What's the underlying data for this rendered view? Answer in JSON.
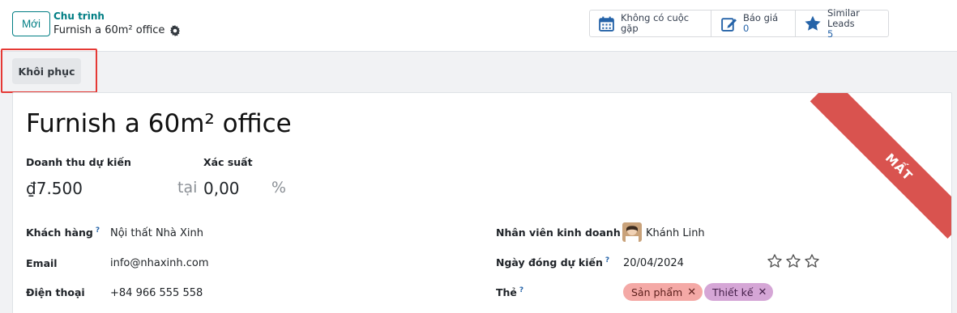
{
  "header": {
    "new_label": "Mới",
    "breadcrumb_parent": "Chu trình",
    "breadcrumb_current": "Furnish a 60m² office"
  },
  "smart_buttons": [
    {
      "icon": "calendar-icon",
      "label": "Không có cuộc gặp",
      "value": ""
    },
    {
      "icon": "edit-icon",
      "label": "Báo giá",
      "value": "0"
    },
    {
      "icon": "star-icon",
      "label": "Similar Leads",
      "value": "5"
    }
  ],
  "statusbar": {
    "restore_label": "Khôi phục"
  },
  "ribbon": {
    "label": "MẤT",
    "color": "#d9534f"
  },
  "form": {
    "title": "Furnish a 60m² office",
    "expected_revenue_label": "Doanh thu dự kiến",
    "expected_revenue_value": "₫7.500",
    "at_label": "tại",
    "probability_label": "Xác suất",
    "probability_value": "0,00",
    "percent_sign": "%",
    "customer_label": "Khách hàng",
    "customer_help": "?",
    "customer_value": "Nội thất Nhà Xinh",
    "email_label": "Email",
    "email_value": "info@nhaxinh.com",
    "phone_label": "Điện thoại",
    "phone_value": "+84 966 555 558",
    "salesperson_label": "Nhân viên kinh doanh",
    "salesperson_value": "Khánh Linh",
    "deadline_label": "Ngày đóng dự kiến",
    "deadline_help": "?",
    "deadline_value": "20/04/2024",
    "priority_stars": 0,
    "tags_label": "Thẻ",
    "tags_help": "?",
    "tags": [
      {
        "label": "Sản phẩm",
        "color": "#f4a9a6"
      },
      {
        "label": "Thiết kế",
        "color": "#d5a6d6"
      }
    ]
  },
  "colors": {
    "accent": "#017e84",
    "link": "#2563a8",
    "highlight": "#e53935"
  }
}
